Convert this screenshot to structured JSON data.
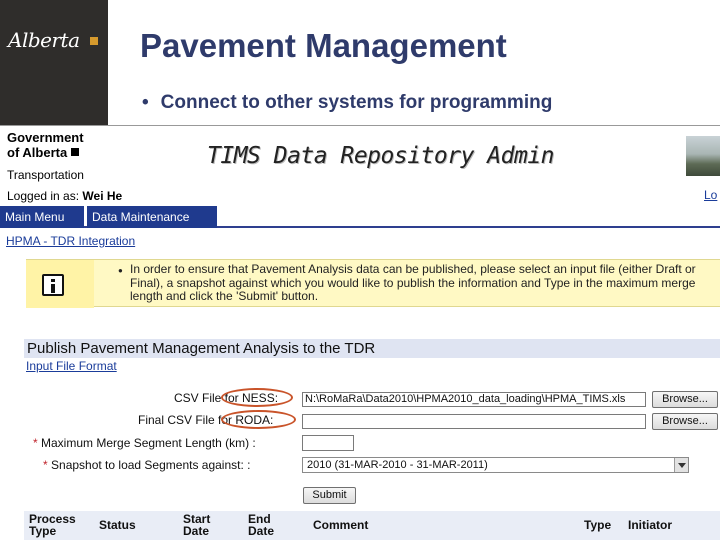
{
  "slide": {
    "logo_text": "Alberta",
    "title": "Pavement Management",
    "bullet_symbol": "•",
    "bullet_text": "Connect to other systems for programming"
  },
  "app": {
    "org_line1": "Government",
    "org_line2": "of Alberta",
    "department": "Transportation",
    "title": "TIMS Data Repository Admin",
    "logged_label": "Logged in as:",
    "logged_user": "Wei He",
    "logout_label": "Lo"
  },
  "nav": {
    "tabs": [
      {
        "label": "Main Menu"
      },
      {
        "label": "Data Maintenance"
      }
    ]
  },
  "breadcrumb": "HPMA - TDR Integration",
  "info": {
    "icon": "info-icon",
    "bullet": "●",
    "text": "In order to ensure that Pavement Analysis data can be published, please select an input file (either Draft or Final), a snapshot against which you would like to publish the information and Type in the maximum merge length and click the 'Submit' button."
  },
  "form": {
    "section_title": "Publish Pavement Management Analysis to the TDR",
    "input_format_link": "Input File Format",
    "csv_ness_label": "CSV File for NESS:",
    "csv_ness_value": "N:\\RoMaRa\\Data2010\\HPMA2010_data_loading\\HPMA_TIMS.xls",
    "final_csv_label": "Final CSV File for RODA:",
    "final_csv_value": "",
    "browse_label": "Browse...",
    "required_marker": "*",
    "max_merge_label": "Maximum Merge Segment Length (km) :",
    "max_merge_value": "",
    "snapshot_label": "Snapshot to load Segments against: :",
    "snapshot_value": "2010   (31-MAR-2010 - 31-MAR-2011)",
    "submit_label": "Submit"
  },
  "table": {
    "headers": [
      {
        "line1": "Process",
        "line2": "Type"
      },
      {
        "line1": "Status",
        "line2": ""
      },
      {
        "line1": "Start",
        "line2": "Date"
      },
      {
        "line1": "End",
        "line2": "Date"
      },
      {
        "line1": "Comment",
        "line2": ""
      },
      {
        "line1": "Type",
        "line2": ""
      },
      {
        "line1": "Initiator",
        "line2": ""
      }
    ]
  },
  "colors": {
    "title": "#2f3b6b",
    "nav_tab": "#1f3a8e",
    "info_bg": "#fff9c4",
    "highlight_oval": "#c9542a",
    "required": "#c0242c"
  }
}
